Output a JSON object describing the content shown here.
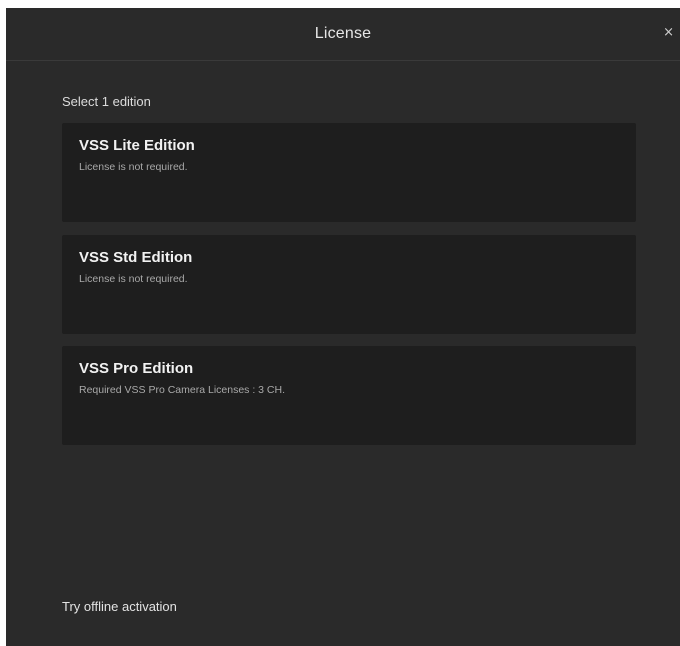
{
  "dialog": {
    "title": "License",
    "close_label": "×"
  },
  "prompt": "Select 1 edition",
  "editions": [
    {
      "name": "VSS Lite Edition",
      "description": "License is not required."
    },
    {
      "name": "VSS Std Edition",
      "description": "License is not required."
    },
    {
      "name": "VSS Pro Edition",
      "description": "Required VSS Pro Camera Licenses : 3 CH."
    }
  ],
  "offline_activation_label": "Try offline activation",
  "colors": {
    "dialog_background": "#2a2a2a",
    "card_background": "#1e1e1e",
    "header_divider": "#3a3a3a"
  }
}
